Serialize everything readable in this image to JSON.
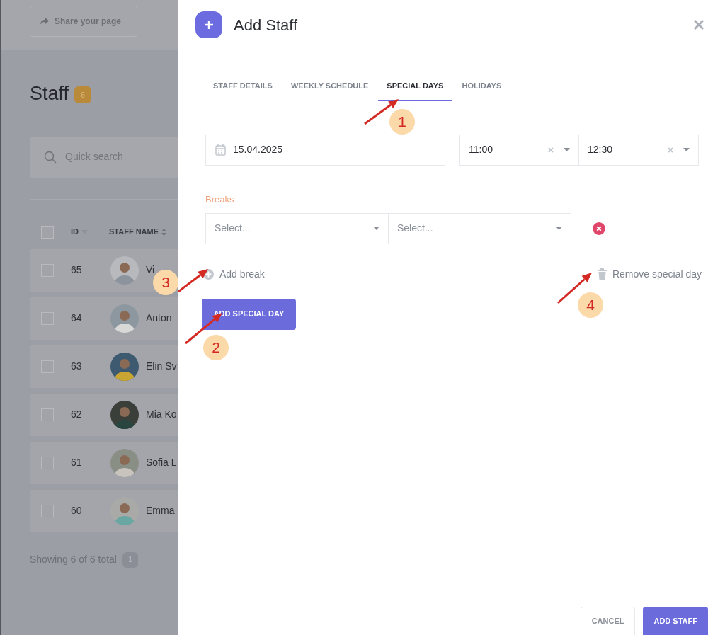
{
  "background_page": {
    "share_button": "Share your page",
    "title": "Staff",
    "count_badge": "6",
    "search": {
      "placeholder": "Quick search"
    },
    "table": {
      "select_all_checked": false,
      "columns": [
        "ID",
        "STAFF NAME"
      ],
      "rows": [
        {
          "id": "65",
          "name": "Vi",
          "checked": false
        },
        {
          "id": "64",
          "name": "Anton",
          "checked": false
        },
        {
          "id": "63",
          "name": "Elin Sv",
          "checked": false
        },
        {
          "id": "62",
          "name": "Mia Ko",
          "checked": false
        },
        {
          "id": "61",
          "name": "Sofia L",
          "checked": false
        },
        {
          "id": "60",
          "name": "Emma",
          "checked": false
        }
      ]
    },
    "footer": "Showing 6 of 6 total",
    "page": "1"
  },
  "dialog": {
    "title": "Add Staff",
    "tabs": [
      {
        "label": "STAFF DETAILS",
        "selected": false
      },
      {
        "label": "WEEKLY SCHEDULE",
        "selected": false
      },
      {
        "label": "SPECIAL DAYS",
        "selected": true
      },
      {
        "label": "HOLIDAYS",
        "selected": false
      }
    ],
    "date": "15.04.2025",
    "start_time": "11:00",
    "end_time": "12:30",
    "breaks_label": "Breaks",
    "breaks": [
      {
        "start": {
          "placeholder": "Select..."
        },
        "end": {
          "placeholder": "Select..."
        }
      }
    ],
    "add_break": "Add break",
    "remove_special_day": "Remove special day",
    "add_special_day": "ADD SPECIAL DAY",
    "buttons": [
      {
        "label": "CANCEL",
        "kind": "secondary"
      },
      {
        "label": "ADD STAFF",
        "kind": "primary"
      }
    ]
  },
  "annotations": [
    {
      "label": "1"
    },
    {
      "label": "2"
    },
    {
      "label": "3"
    },
    {
      "label": "4"
    }
  ]
}
